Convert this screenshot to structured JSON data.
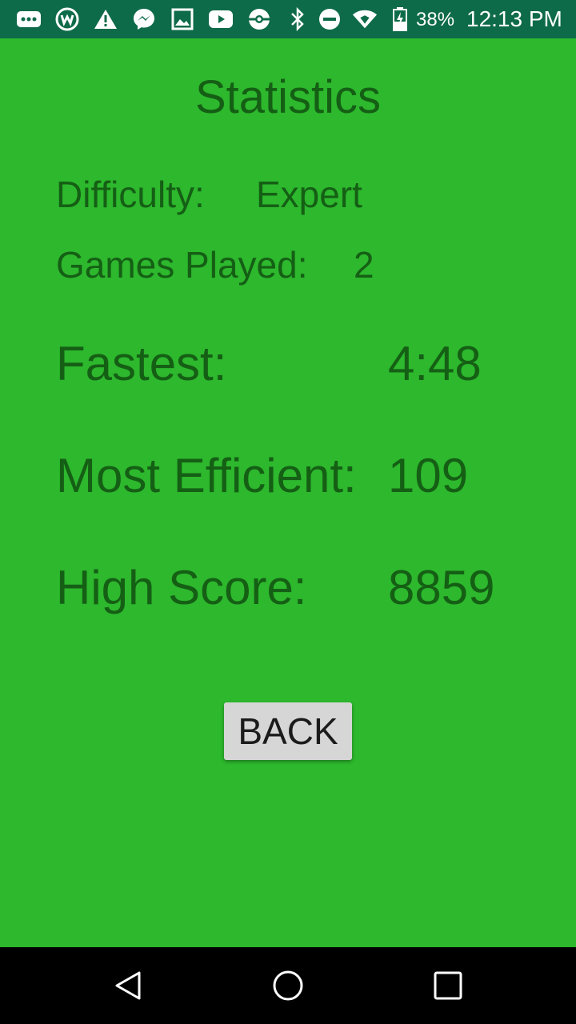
{
  "status_bar": {
    "icons": [
      "more-dots-icon",
      "wattpad-icon",
      "warning-icon",
      "messenger-icon",
      "image-icon",
      "youtube-icon",
      "pokeball-icon",
      "bluetooth-icon",
      "do-not-disturb-icon",
      "wifi-icon",
      "battery-icon"
    ],
    "battery_percent": "38%",
    "time": "12:13 PM"
  },
  "screen": {
    "title": "Statistics",
    "difficulty_label": "Difficulty:",
    "difficulty_value": "Expert",
    "games_played_label": "Games Played:",
    "games_played_value": "2",
    "fastest_label": "Fastest:",
    "fastest_value": "4:48",
    "efficient_label": "Most Efficient:",
    "efficient_value": "109",
    "high_score_label": "High Score:",
    "high_score_value": "8859",
    "back_label": "BACK"
  },
  "colors": {
    "background": "#2db82d",
    "text": "#155f15",
    "status_bar": "#0e6b4a",
    "button": "#d6d6d6"
  },
  "nav_bar": {
    "icons": [
      "back-triangle-icon",
      "home-circle-icon",
      "recents-square-icon"
    ]
  }
}
